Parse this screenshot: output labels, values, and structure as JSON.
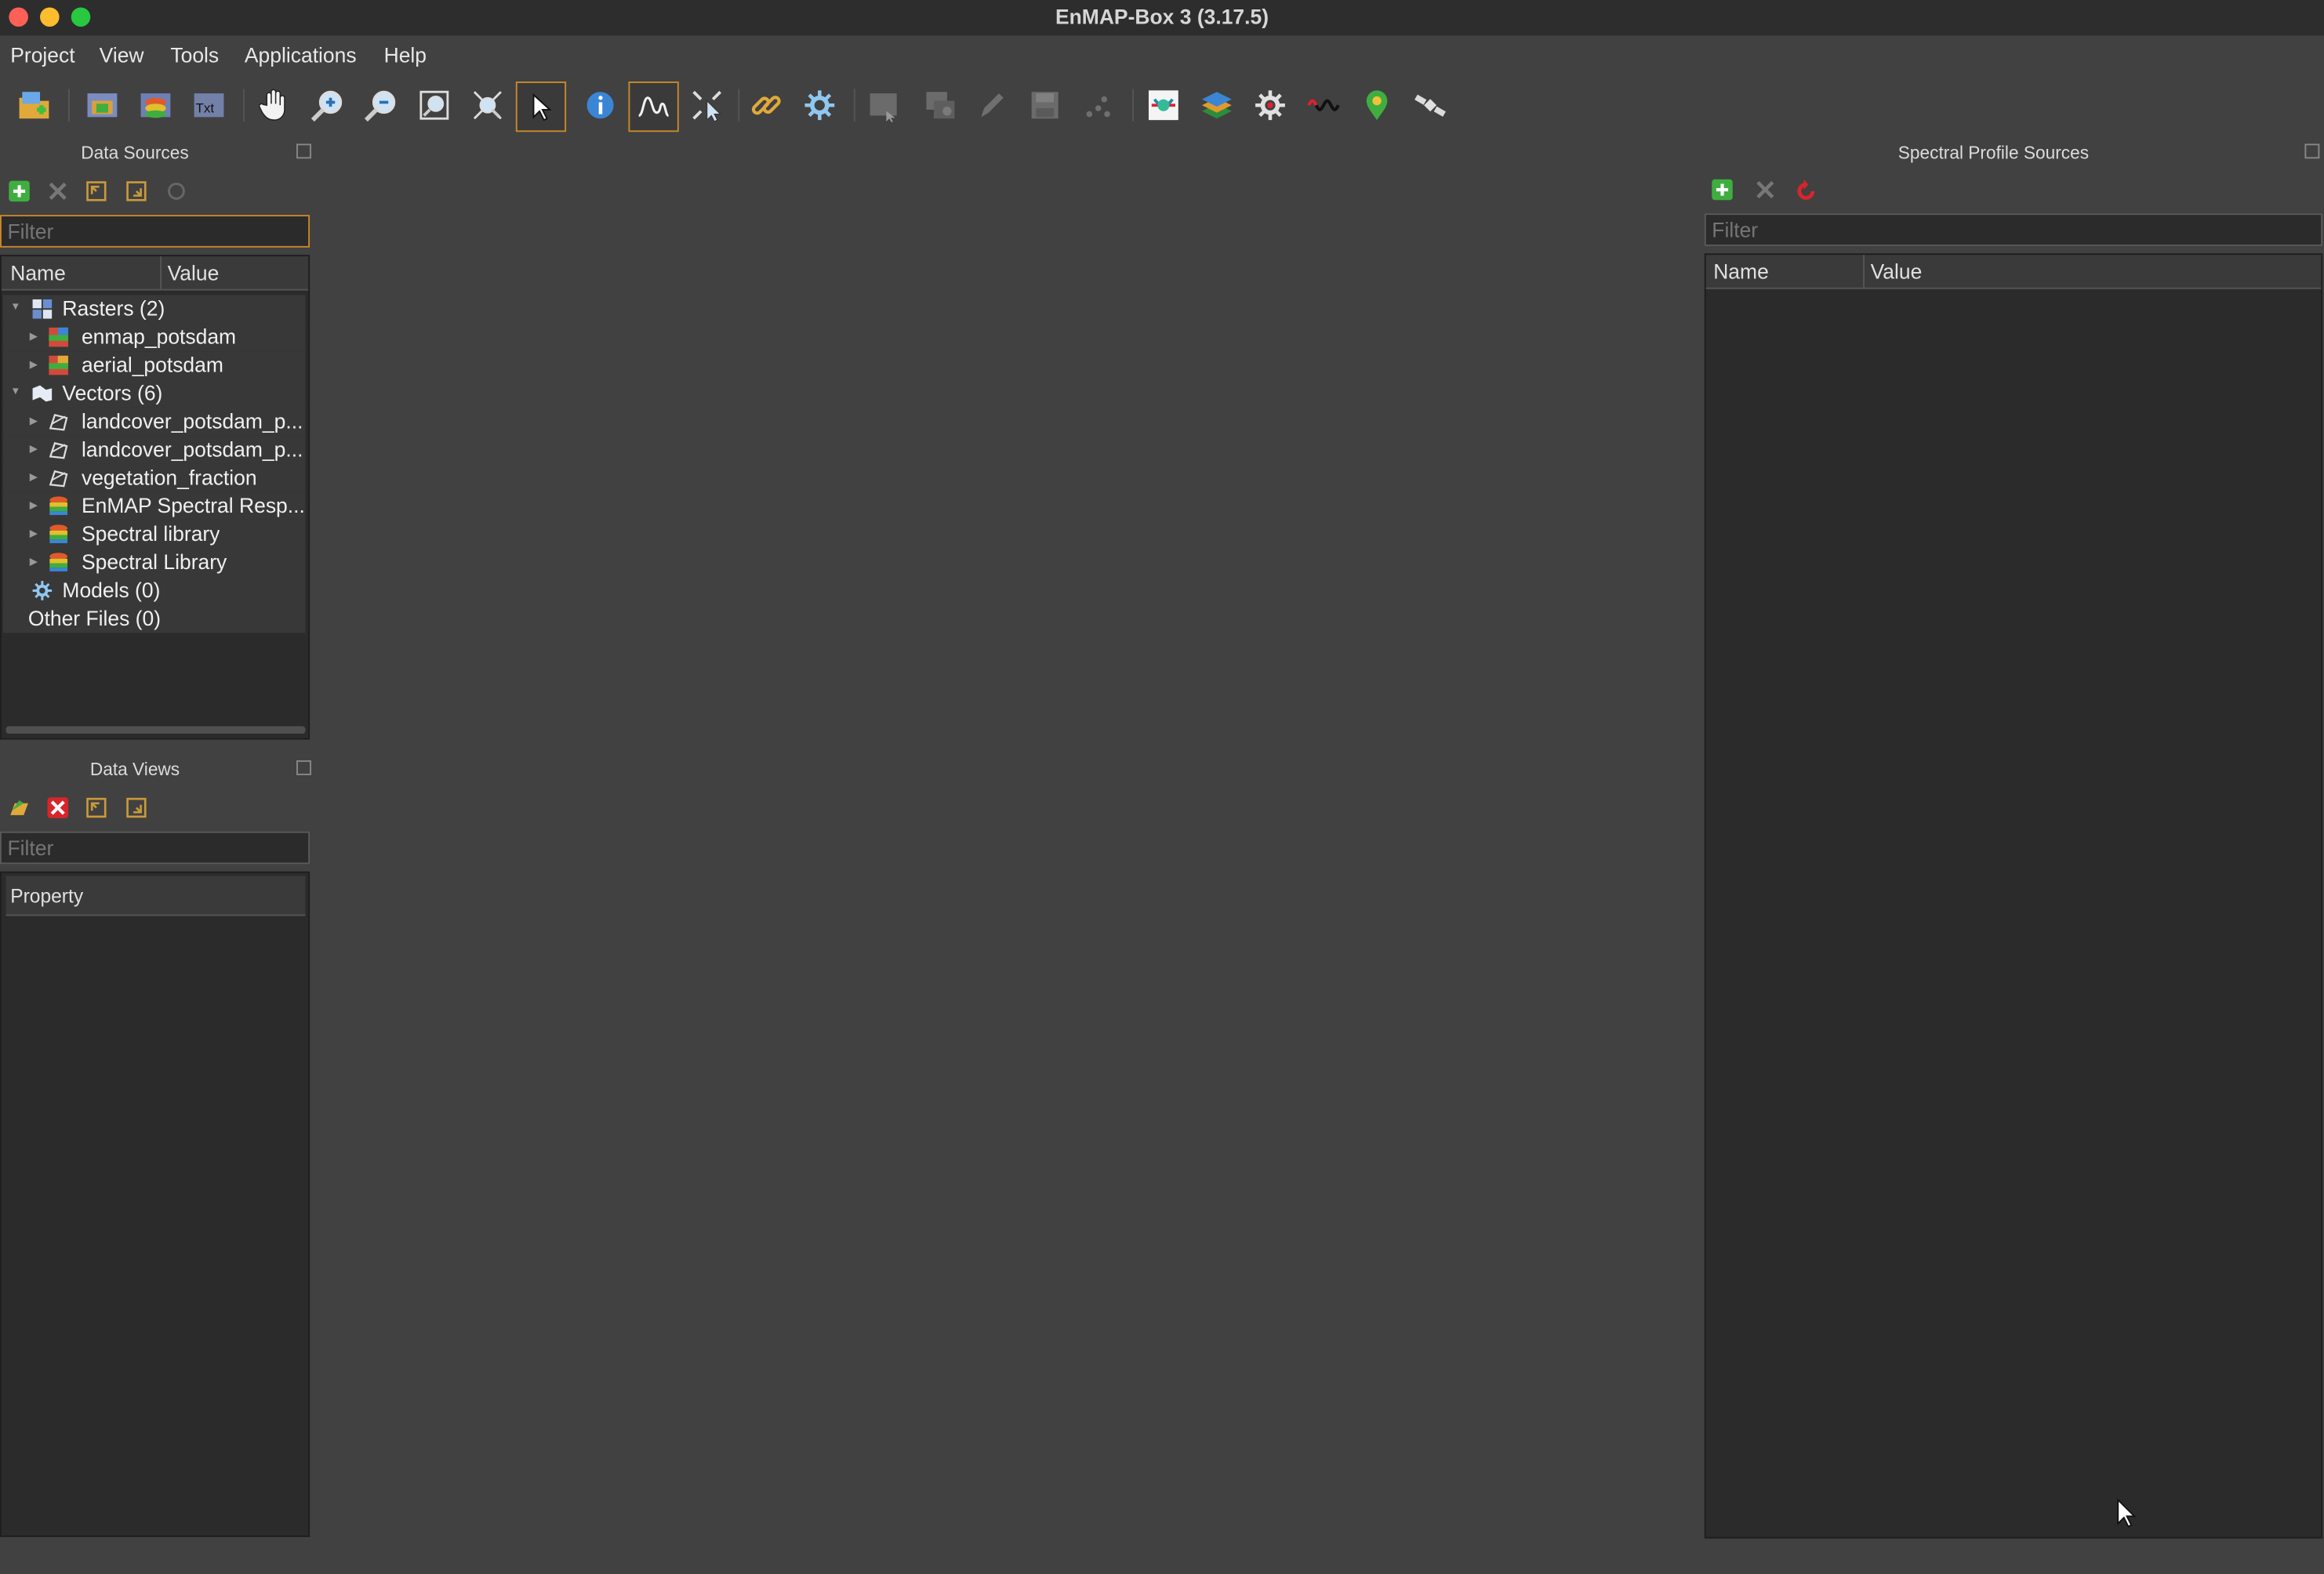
{
  "window": {
    "title": "EnMAP-Box 3 (3.17.5)"
  },
  "menu": {
    "items": [
      "Project",
      "View",
      "Tools",
      "Applications",
      "Help"
    ]
  },
  "toolbar": {
    "icons": [
      "open-project-icon",
      "add-raster-icon",
      "add-vector-icon",
      "add-text-icon",
      "pan-icon",
      "zoom-in-icon",
      "zoom-out-icon",
      "zoom-full-icon",
      "zoom-layer-icon",
      "select-cursor-icon",
      "identify-icon",
      "spectral-profile-icon",
      "move-center-icon",
      "link-icon",
      "settings-gear-icon",
      "new-map-view-icon",
      "new-spectral-view-icon",
      "edit-pencil-icon",
      "save-icon",
      "add-points-icon",
      "image-cube-icon",
      "layers-icon",
      "processing-gear-icon",
      "spectral-line-icon",
      "location-pin-icon",
      "satellite-icon"
    ]
  },
  "data_sources": {
    "title": "Data Sources",
    "filter_placeholder": "Filter",
    "col_name": "Name",
    "col_value": "Value",
    "rows": [
      {
        "label": "Rasters (2)",
        "icon": "raster-group-icon"
      },
      {
        "label": "enmap_potsdam",
        "icon": "raster-icon"
      },
      {
        "label": "aerial_potsdam",
        "icon": "raster-icon"
      },
      {
        "label": "Vectors (6)",
        "icon": "vector-group-icon"
      },
      {
        "label": "landcover_potsdam_p...",
        "icon": "polygon-icon"
      },
      {
        "label": "landcover_potsdam_p...",
        "icon": "polygon-icon"
      },
      {
        "label": "vegetation_fraction",
        "icon": "polygon-icon"
      },
      {
        "label": "EnMAP Spectral Resp...",
        "icon": "spectral-library-icon"
      },
      {
        "label": "Spectral library",
        "icon": "spectral-library-icon"
      },
      {
        "label": "Spectral Library",
        "icon": "spectral-library-icon"
      },
      {
        "label": "Models (0)",
        "icon": "model-icon"
      },
      {
        "label": "Other Files (0)",
        "icon": ""
      }
    ]
  },
  "data_views": {
    "title": "Data Views",
    "filter_placeholder": "Filter",
    "col_property": "Property"
  },
  "spectral_profile_sources": {
    "title": "Spectral Profile Sources",
    "filter_placeholder": "Filter",
    "col_name": "Name",
    "col_value": "Value"
  },
  "colors": {
    "accent": "#c98a2b",
    "background": "#414141",
    "panel": "#2b2b2b"
  }
}
